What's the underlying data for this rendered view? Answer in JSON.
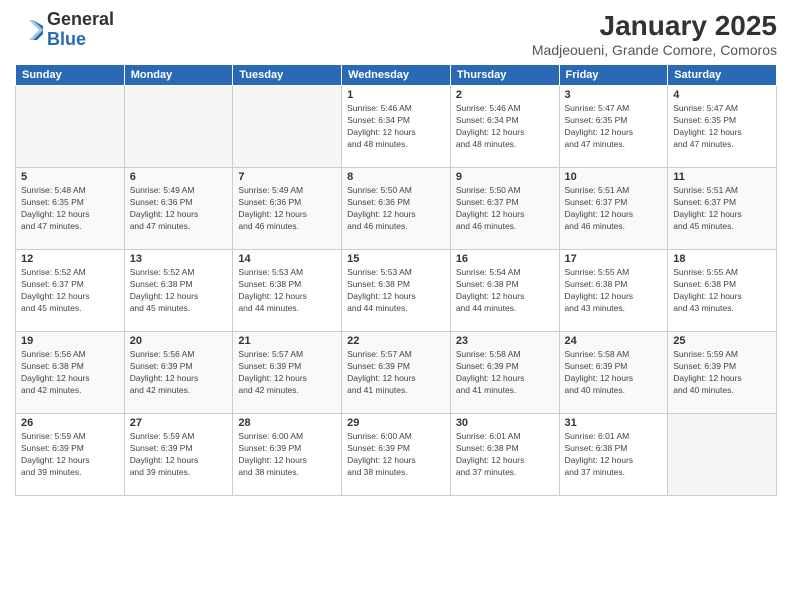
{
  "logo": {
    "general": "General",
    "blue": "Blue"
  },
  "title": "January 2025",
  "subtitle": "Madjeoueni, Grande Comore, Comoros",
  "days_of_week": [
    "Sunday",
    "Monday",
    "Tuesday",
    "Wednesday",
    "Thursday",
    "Friday",
    "Saturday"
  ],
  "weeks": [
    [
      {
        "day": "",
        "info": ""
      },
      {
        "day": "",
        "info": ""
      },
      {
        "day": "",
        "info": ""
      },
      {
        "day": "1",
        "info": "Sunrise: 5:46 AM\nSunset: 6:34 PM\nDaylight: 12 hours\nand 48 minutes."
      },
      {
        "day": "2",
        "info": "Sunrise: 5:46 AM\nSunset: 6:34 PM\nDaylight: 12 hours\nand 48 minutes."
      },
      {
        "day": "3",
        "info": "Sunrise: 5:47 AM\nSunset: 6:35 PM\nDaylight: 12 hours\nand 47 minutes."
      },
      {
        "day": "4",
        "info": "Sunrise: 5:47 AM\nSunset: 6:35 PM\nDaylight: 12 hours\nand 47 minutes."
      }
    ],
    [
      {
        "day": "5",
        "info": "Sunrise: 5:48 AM\nSunset: 6:35 PM\nDaylight: 12 hours\nand 47 minutes."
      },
      {
        "day": "6",
        "info": "Sunrise: 5:49 AM\nSunset: 6:36 PM\nDaylight: 12 hours\nand 47 minutes."
      },
      {
        "day": "7",
        "info": "Sunrise: 5:49 AM\nSunset: 6:36 PM\nDaylight: 12 hours\nand 46 minutes."
      },
      {
        "day": "8",
        "info": "Sunrise: 5:50 AM\nSunset: 6:36 PM\nDaylight: 12 hours\nand 46 minutes."
      },
      {
        "day": "9",
        "info": "Sunrise: 5:50 AM\nSunset: 6:37 PM\nDaylight: 12 hours\nand 46 minutes."
      },
      {
        "day": "10",
        "info": "Sunrise: 5:51 AM\nSunset: 6:37 PM\nDaylight: 12 hours\nand 46 minutes."
      },
      {
        "day": "11",
        "info": "Sunrise: 5:51 AM\nSunset: 6:37 PM\nDaylight: 12 hours\nand 45 minutes."
      }
    ],
    [
      {
        "day": "12",
        "info": "Sunrise: 5:52 AM\nSunset: 6:37 PM\nDaylight: 12 hours\nand 45 minutes."
      },
      {
        "day": "13",
        "info": "Sunrise: 5:52 AM\nSunset: 6:38 PM\nDaylight: 12 hours\nand 45 minutes."
      },
      {
        "day": "14",
        "info": "Sunrise: 5:53 AM\nSunset: 6:38 PM\nDaylight: 12 hours\nand 44 minutes."
      },
      {
        "day": "15",
        "info": "Sunrise: 5:53 AM\nSunset: 6:38 PM\nDaylight: 12 hours\nand 44 minutes."
      },
      {
        "day": "16",
        "info": "Sunrise: 5:54 AM\nSunset: 6:38 PM\nDaylight: 12 hours\nand 44 minutes."
      },
      {
        "day": "17",
        "info": "Sunrise: 5:55 AM\nSunset: 6:38 PM\nDaylight: 12 hours\nand 43 minutes."
      },
      {
        "day": "18",
        "info": "Sunrise: 5:55 AM\nSunset: 6:38 PM\nDaylight: 12 hours\nand 43 minutes."
      }
    ],
    [
      {
        "day": "19",
        "info": "Sunrise: 5:56 AM\nSunset: 6:38 PM\nDaylight: 12 hours\nand 42 minutes."
      },
      {
        "day": "20",
        "info": "Sunrise: 5:56 AM\nSunset: 6:39 PM\nDaylight: 12 hours\nand 42 minutes."
      },
      {
        "day": "21",
        "info": "Sunrise: 5:57 AM\nSunset: 6:39 PM\nDaylight: 12 hours\nand 42 minutes."
      },
      {
        "day": "22",
        "info": "Sunrise: 5:57 AM\nSunset: 6:39 PM\nDaylight: 12 hours\nand 41 minutes."
      },
      {
        "day": "23",
        "info": "Sunrise: 5:58 AM\nSunset: 6:39 PM\nDaylight: 12 hours\nand 41 minutes."
      },
      {
        "day": "24",
        "info": "Sunrise: 5:58 AM\nSunset: 6:39 PM\nDaylight: 12 hours\nand 40 minutes."
      },
      {
        "day": "25",
        "info": "Sunrise: 5:59 AM\nSunset: 6:39 PM\nDaylight: 12 hours\nand 40 minutes."
      }
    ],
    [
      {
        "day": "26",
        "info": "Sunrise: 5:59 AM\nSunset: 6:39 PM\nDaylight: 12 hours\nand 39 minutes."
      },
      {
        "day": "27",
        "info": "Sunrise: 5:59 AM\nSunset: 6:39 PM\nDaylight: 12 hours\nand 39 minutes."
      },
      {
        "day": "28",
        "info": "Sunrise: 6:00 AM\nSunset: 6:39 PM\nDaylight: 12 hours\nand 38 minutes."
      },
      {
        "day": "29",
        "info": "Sunrise: 6:00 AM\nSunset: 6:39 PM\nDaylight: 12 hours\nand 38 minutes."
      },
      {
        "day": "30",
        "info": "Sunrise: 6:01 AM\nSunset: 6:38 PM\nDaylight: 12 hours\nand 37 minutes."
      },
      {
        "day": "31",
        "info": "Sunrise: 6:01 AM\nSunset: 6:38 PM\nDaylight: 12 hours\nand 37 minutes."
      },
      {
        "day": "",
        "info": ""
      }
    ]
  ]
}
